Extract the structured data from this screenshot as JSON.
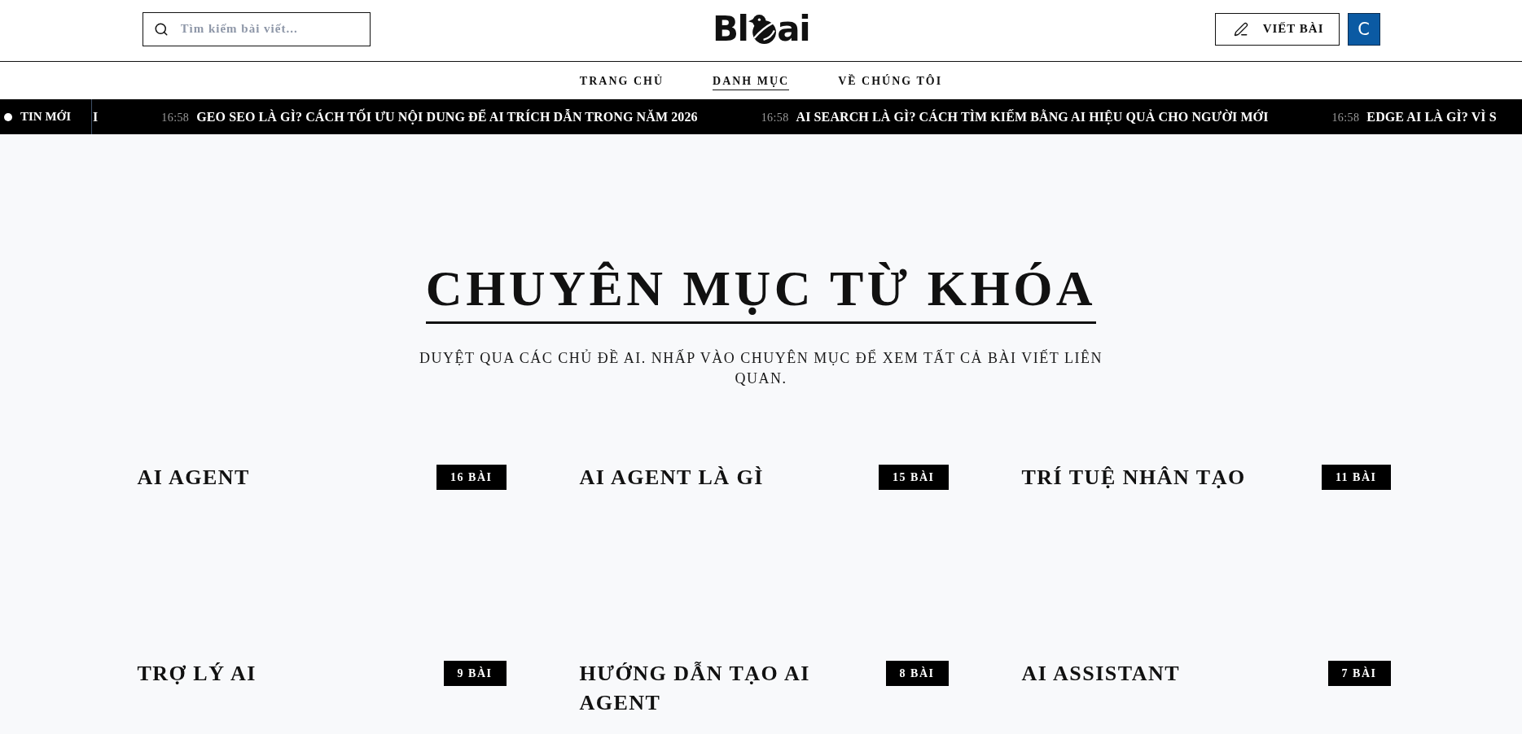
{
  "header": {
    "search": {
      "placeholder": "Tìm kiếm bài viết..."
    },
    "logo": {
      "text_start": "Bl",
      "text_end": "ai"
    },
    "write_button": "VIẾT BÀI",
    "avatar": "C"
  },
  "nav": [
    {
      "label": "TRANG CHỦ",
      "selected": false
    },
    {
      "label": "DANH MỤC",
      "selected": true
    },
    {
      "label": "VỀ CHÚNG TÔI",
      "selected": false
    }
  ],
  "ticker": {
    "label": "TIN MỚI",
    "items": [
      {
        "headline": "I"
      },
      {
        "time": "16:58",
        "headline": "GEO SEO LÀ GÌ? CÁCH TỐI ƯU NỘI DUNG ĐỂ AI TRÍCH DẪN TRONG NĂM 2026"
      },
      {
        "time": "16:58",
        "headline": "AI SEARCH LÀ GÌ? CÁCH TÌM KIẾM BẰNG AI HIỆU QUẢ CHO NGƯỜI MỚI"
      },
      {
        "time": "16:58",
        "headline": "EDGE AI LÀ GÌ? VÌ S"
      }
    ]
  },
  "page": {
    "title": "CHUYÊN MỤC TỪ KHÓA",
    "subtitle": "DUYỆT QUA CÁC CHỦ ĐỀ AI. NHẤP VÀO CHUYÊN MỤC ĐỂ XEM TẤT CẢ BÀI VIẾT LIÊN QUAN."
  },
  "categories": [
    {
      "name": "AI AGENT",
      "count": "16 BÀI"
    },
    {
      "name": "AI AGENT LÀ GÌ",
      "count": "15 BÀI"
    },
    {
      "name": "TRÍ TUỆ NHÂN TẠO",
      "count": "11 BÀI"
    },
    {
      "name": "TRỢ LÝ AI",
      "count": "9 BÀI"
    },
    {
      "name": "HƯỚNG DẪN TẠO AI AGENT",
      "count": "8 BÀI"
    },
    {
      "name": "AI ASSISTANT",
      "count": "7 BÀI"
    }
  ]
}
